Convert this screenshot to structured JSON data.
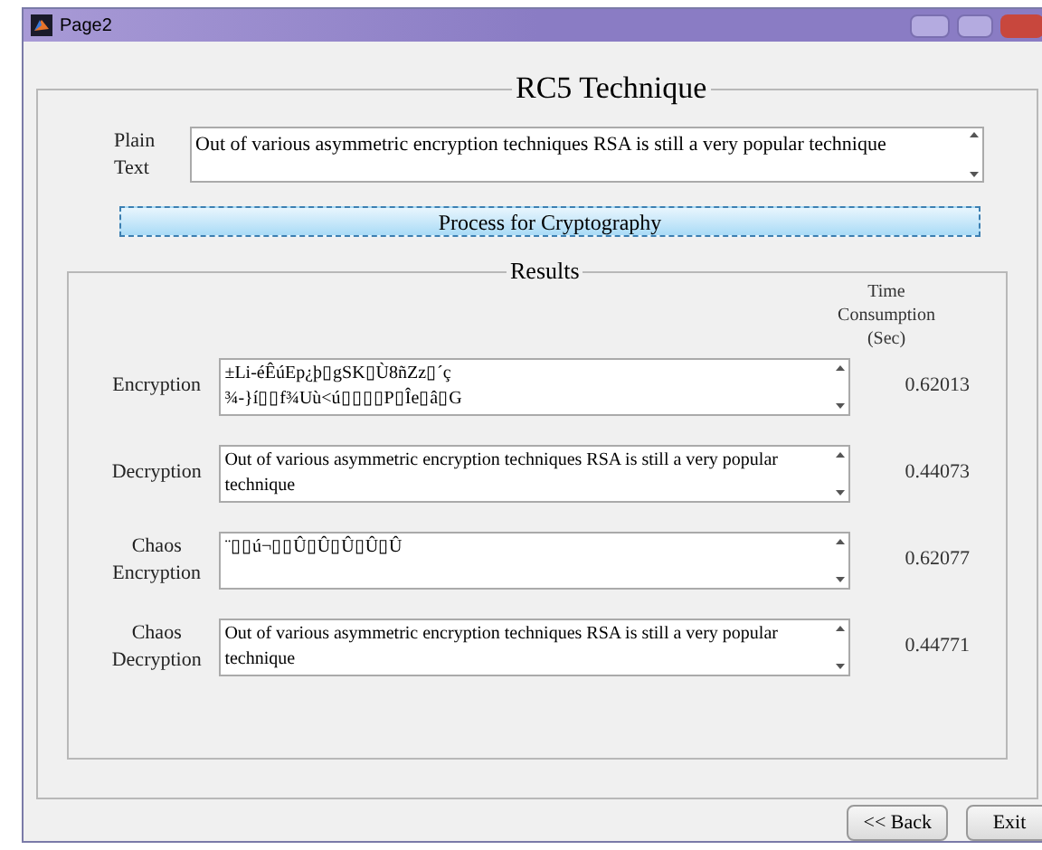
{
  "window": {
    "title": "Page2"
  },
  "panel": {
    "title": "RC5 Technique"
  },
  "plain_text": {
    "label": "Plain Text",
    "value": "Out of various asymmetric encryption techniques RSA is still a very popular technique"
  },
  "process_button": "Process for Cryptography",
  "results": {
    "title": "Results",
    "time_header": "Time Consumption (Sec)",
    "rows": [
      {
        "label": "Encryption",
        "value": "±Li-éÊúEp¿þ▯gSK▯Ù8ñZz▯´ç\n¾-}í▯▯f¾Uù<ú▯▯▯▯P▯Îe▯â▯G",
        "time": "0.62013"
      },
      {
        "label": "Decryption",
        "value": "Out of various asymmetric encryption techniques RSA is still a very popular technique",
        "time": "0.44073"
      },
      {
        "label": "Chaos Encryption",
        "value": "¨▯▯ú¬▯▯Û▯Û▯Û▯Û▯Û",
        "time": "0.62077"
      },
      {
        "label": "Chaos Decryption",
        "value": "Out of various asymmetric encryption techniques RSA is still a very popular technique",
        "time": "0.44771"
      }
    ]
  },
  "buttons": [
    "<< Back",
    "Exit"
  ]
}
